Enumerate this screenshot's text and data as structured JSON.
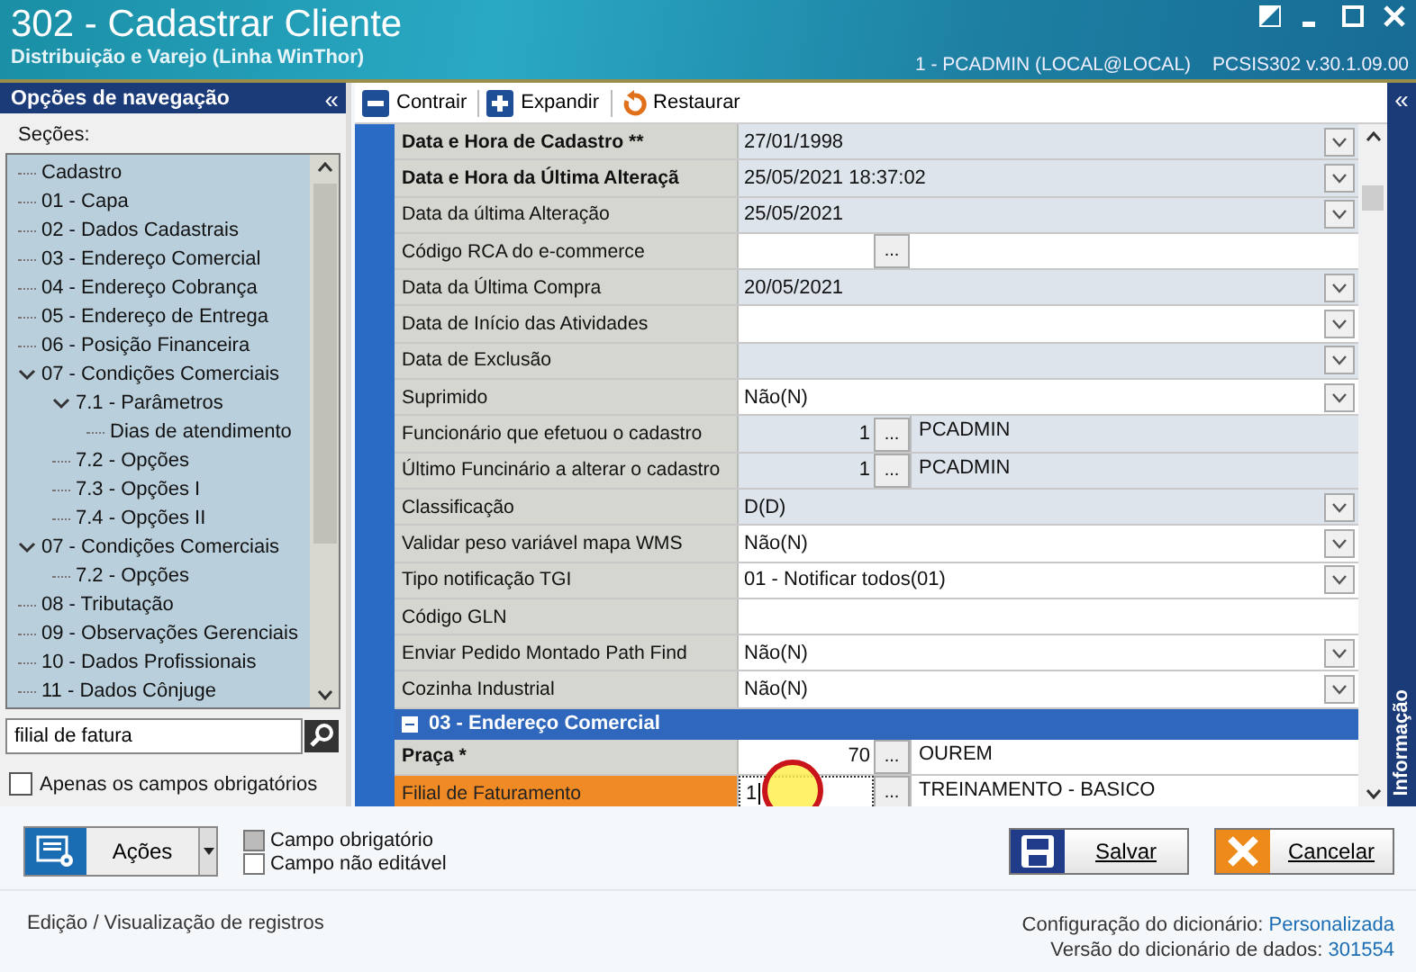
{
  "window": {
    "title": "302 - Cadastrar Cliente",
    "subtitle": "Distribuição e Varejo (Linha WinThor)",
    "user": "1 - PCADMIN (LOCAL@LOCAL)",
    "version": "PCSIS302  v.30.1.09.00"
  },
  "nav": {
    "title": "Opções de navegação",
    "collapse": "«",
    "sections_label": "Seções:",
    "tree": [
      {
        "label": "Cadastro"
      },
      {
        "label": "01 - Capa"
      },
      {
        "label": "02 - Dados Cadastrais"
      },
      {
        "label": "03 - Endereço Comercial"
      },
      {
        "label": "04 - Endereço Cobrança"
      },
      {
        "label": "05 - Endereço de Entrega"
      },
      {
        "label": "06 - Posição Financeira"
      },
      {
        "label": "07 - Condições Comerciais",
        "expanded": true,
        "children": [
          {
            "label": "7.1 - Parâmetros",
            "expanded": true,
            "children": [
              {
                "label": "Dias de atendimento"
              }
            ]
          },
          {
            "label": "7.2 - Opções"
          },
          {
            "label": "7.3 - Opções I"
          },
          {
            "label": "7.4 - Opções II"
          }
        ]
      },
      {
        "label": "07 - Condições Comerciais",
        "expanded": true,
        "children": [
          {
            "label": "7.2 - Opções"
          }
        ]
      },
      {
        "label": "08 - Tributação"
      },
      {
        "label": "09 - Observações Gerenciais"
      },
      {
        "label": "10 - Dados Profissionais"
      },
      {
        "label": "11 - Dados Cônjuge"
      }
    ],
    "search": {
      "value": "filial de fatura"
    },
    "required_only": {
      "label": "Apenas os campos obrigatórios",
      "checked": false
    }
  },
  "toolbar": [
    {
      "label": "Contrair",
      "kind": "collapse"
    },
    {
      "label": "Expandir",
      "kind": "expand"
    },
    {
      "label": "Restaurar",
      "kind": "restore"
    }
  ],
  "grid": [
    {
      "kind": "combo",
      "label": "Data e Hora de Cadastro **",
      "bold": true,
      "editable": false,
      "selected": false,
      "value": "27/01/1998"
    },
    {
      "kind": "combo",
      "label": "Data e Hora da Última Alteraçã",
      "bold": true,
      "editable": false,
      "selected": false,
      "value": "25/05/2021 18:37:02"
    },
    {
      "kind": "combo",
      "label": "Data da última Alteração",
      "bold": false,
      "editable": false,
      "selected": false,
      "value": "25/05/2021"
    },
    {
      "kind": "lookup",
      "label": "Código RCA do e-commerce",
      "bold": false,
      "editable": true,
      "selected": false,
      "button": "..."
    },
    {
      "kind": "combo",
      "label": "Data da Última Compra",
      "bold": false,
      "editable": false,
      "selected": false,
      "value": "20/05/2021"
    },
    {
      "kind": "combo",
      "label": "Data de Início das Atividades",
      "bold": false,
      "editable": true,
      "selected": false
    },
    {
      "kind": "combo",
      "label": "Data de Exclusão",
      "bold": false,
      "editable": false,
      "selected": false
    },
    {
      "kind": "combo",
      "label": "Suprimido",
      "bold": false,
      "editable": true,
      "selected": false,
      "value": "Não(N)"
    },
    {
      "kind": "lookup",
      "label": "Funcionário que efetuou o cadastro",
      "bold": false,
      "editable": false,
      "selected": false,
      "code": "1",
      "button": "...",
      "description": "PCADMIN"
    },
    {
      "kind": "lookup",
      "label": "Último Funcinário a alterar o cadastro",
      "bold": false,
      "editable": false,
      "selected": false,
      "code": "1",
      "button": "...",
      "description": "PCADMIN"
    },
    {
      "kind": "combo",
      "label": "Classificação",
      "bold": false,
      "editable": false,
      "selected": false,
      "value": "D(D)"
    },
    {
      "kind": "combo",
      "label": "Validar peso variável mapa WMS",
      "bold": false,
      "editable": true,
      "selected": false,
      "value": "Não(N)"
    },
    {
      "kind": "combo",
      "label": "Tipo notificação TGI",
      "bold": false,
      "editable": true,
      "selected": false,
      "value": "01 - Notificar todos(01)"
    },
    {
      "kind": "text",
      "label": "Código GLN",
      "bold": false,
      "editable": true,
      "selected": false
    },
    {
      "kind": "combo",
      "label": "Enviar Pedido Montado Path Find",
      "bold": false,
      "editable": true,
      "selected": false,
      "value": "Não(N)"
    },
    {
      "kind": "combo",
      "label": "Cozinha Industrial",
      "bold": false,
      "editable": true,
      "selected": false,
      "value": "Não(N)"
    },
    {
      "kind": "section",
      "label": "03 - Endereço Comercial",
      "expanded": true
    },
    {
      "kind": "lookup",
      "label": "Praça *",
      "bold": true,
      "editable": true,
      "selected": false,
      "code": "70",
      "button": "...",
      "description": "OUREM"
    },
    {
      "kind": "lookup",
      "label": "Filial de Faturamento",
      "bold": false,
      "editable": true,
      "selected": true,
      "code": "1",
      "button": "...",
      "description": "TREINAMENTO - BASICO"
    }
  ],
  "side_panel": {
    "collapse": "«",
    "label": "Informação"
  },
  "actions": {
    "label": "Ações"
  },
  "legend": [
    {
      "label": "Campo obrigatório",
      "kind": "required"
    },
    {
      "label": "Campo não editável",
      "kind": "readonly"
    }
  ],
  "buttons": [
    {
      "label": "Salvar",
      "kind": "save"
    },
    {
      "label": "Cancelar",
      "kind": "cancel"
    }
  ],
  "status": {
    "mode": "Edição / Visualização de registros",
    "config_label": "Configuração do dicionário:",
    "config_value": "Personalizada",
    "version_label": "Versão do dicionário de dados:",
    "version_value": "301554"
  }
}
